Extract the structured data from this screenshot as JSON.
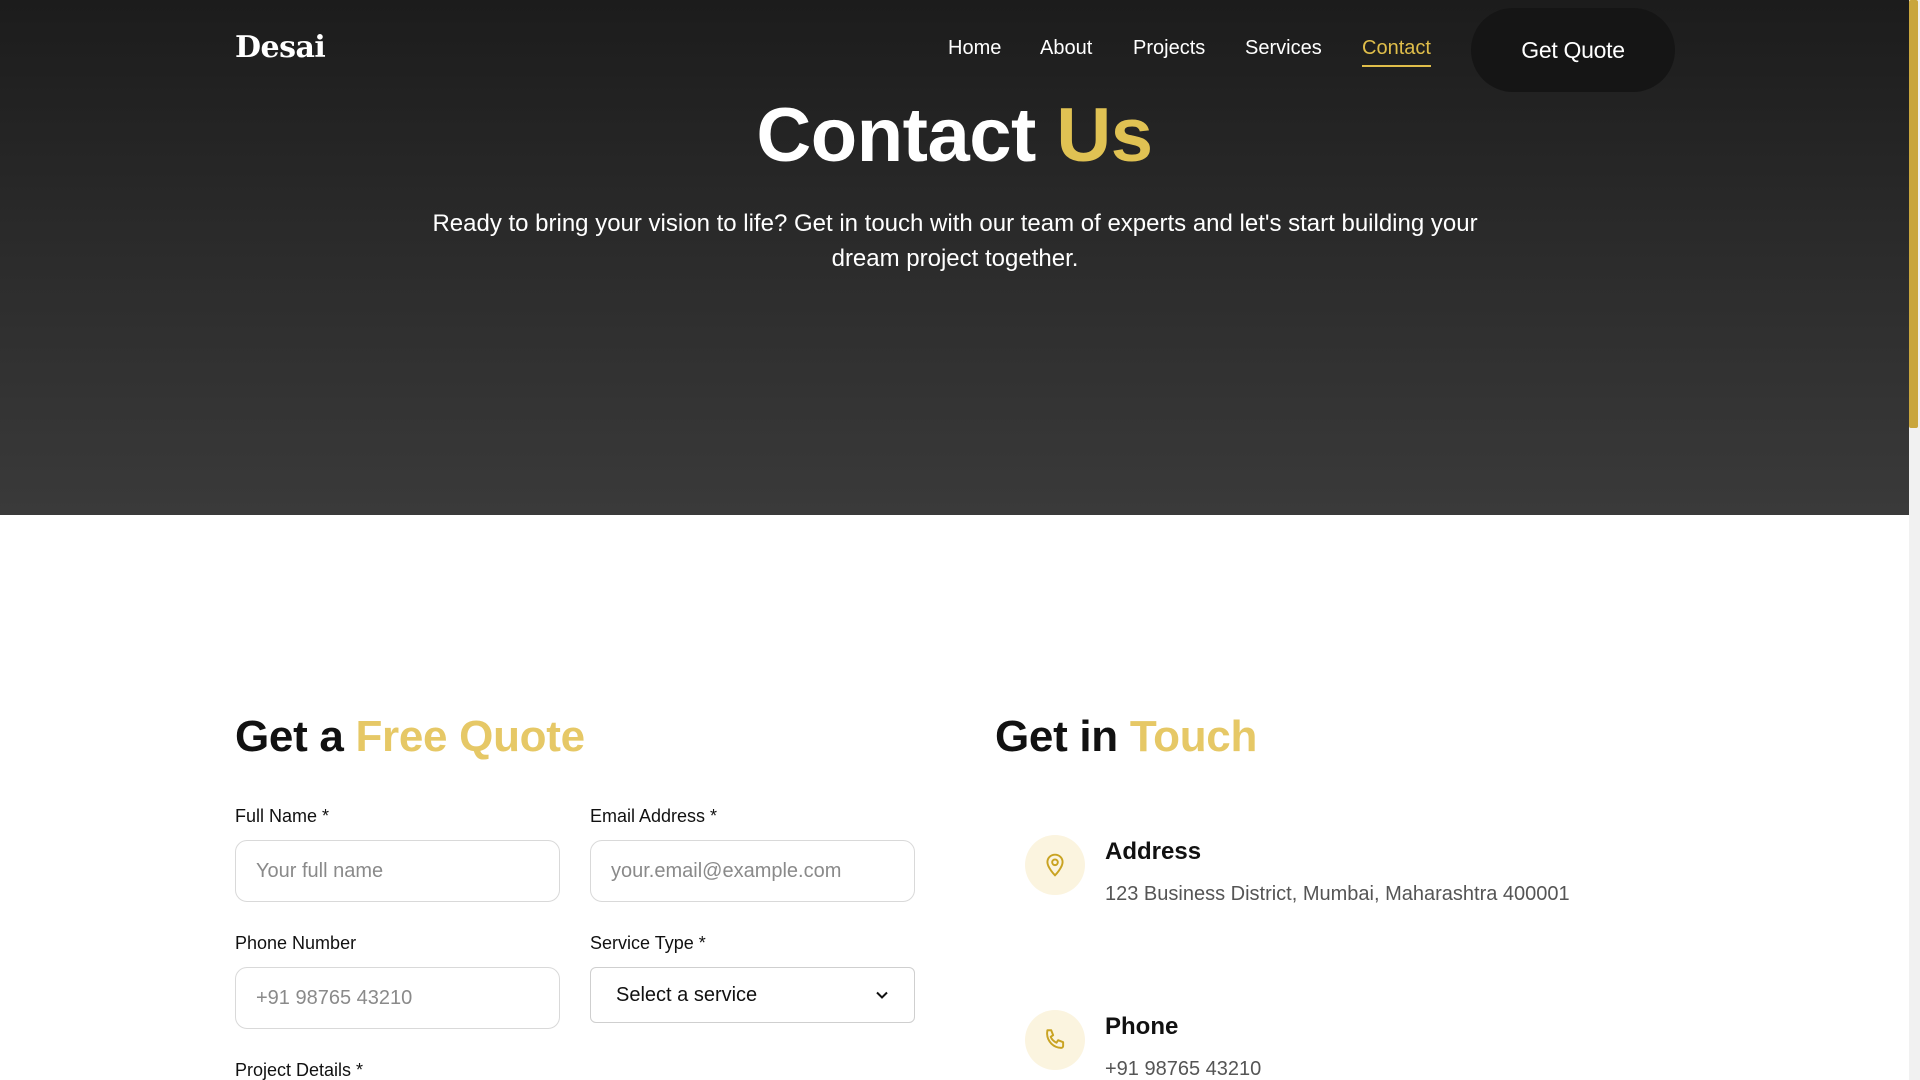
{
  "brand": "Desai",
  "nav": {
    "items": [
      {
        "label": "Home",
        "active": false
      },
      {
        "label": "About",
        "active": false
      },
      {
        "label": "Projects",
        "active": false
      },
      {
        "label": "Services",
        "active": false
      },
      {
        "label": "Contact",
        "active": true
      }
    ],
    "cta_label": "Get Quote"
  },
  "hero": {
    "title_main": "Contact",
    "title_accent": "Us",
    "subtitle_line1": "Ready to bring your vision to life? Get in touch with our team of experts and let's start building your",
    "subtitle_line2": "dream project together."
  },
  "form": {
    "title_main": "Get a",
    "title_accent": "Free Quote",
    "full_name": {
      "label": "Full Name *",
      "placeholder": "Your full name"
    },
    "email": {
      "label": "Email Address *",
      "placeholder": "your.email@example.com"
    },
    "phone": {
      "label": "Phone Number",
      "placeholder": "+91 98765 43210"
    },
    "service": {
      "label": "Service Type *",
      "value": "Select a service"
    },
    "details": {
      "label": "Project Details *"
    }
  },
  "contact": {
    "title_main": "Get in",
    "title_accent": "Touch",
    "address": {
      "title": "Address",
      "text": "123 Business District, Mumbai, Maharashtra 400001"
    },
    "phone": {
      "title": "Phone",
      "text": "+91 98765 43210"
    }
  },
  "colors": {
    "accent": "#e0c253",
    "dark": "#151515"
  }
}
